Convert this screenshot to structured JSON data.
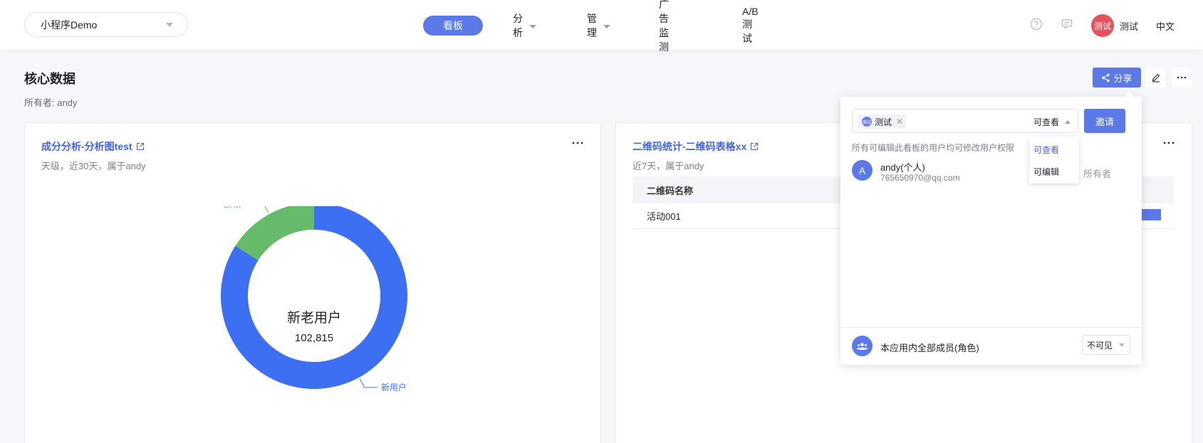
{
  "header": {
    "app_select": "小程序Demo",
    "nav": [
      {
        "label": "看板",
        "active": true
      },
      {
        "label": "分析",
        "has_caret": true
      },
      {
        "label": "管理",
        "has_caret": true
      },
      {
        "label": "广告监测"
      },
      {
        "label": "A/B测试"
      }
    ],
    "avatar_text": "测试",
    "user_name": "测试",
    "language": "中文",
    "icons": [
      "help-circle-icon",
      "message-icon"
    ]
  },
  "page": {
    "title": "核心数据",
    "owner": "所有者: andy",
    "share_label": "分享"
  },
  "card_left": {
    "title": "成分分析-分析图test",
    "subtitle": "天级，近30天，属于andy"
  },
  "card_right": {
    "title": "二维码统计-二维码表格xx",
    "subtitle": "近7天，属于andy",
    "table": {
      "columns": [
        "二维码名称"
      ],
      "rows": [
        [
          "活动001"
        ]
      ]
    }
  },
  "chart_data": {
    "type": "pie",
    "center_title": "新老用户",
    "center_value": "102,815",
    "slices": [
      {
        "label": "新用户",
        "value": 0.84,
        "color": "#3d6ff2"
      },
      {
        "label": "老用户",
        "value": 0.16,
        "color": "#66bb6a"
      }
    ]
  },
  "share_popover": {
    "tag_avatar": "测试",
    "tag_label": "测试",
    "permission_value": "可查看",
    "invite_button": "邀请",
    "hint": "所有可编辑此看板的用户均可修改用户权限",
    "member": {
      "initial": "A",
      "name": "andy(个人)",
      "email": "765650970@qq.com",
      "role": "所有者"
    },
    "dropdown_options": [
      {
        "label": "可查看",
        "selected": true
      },
      {
        "label": "可编辑",
        "selected": false
      }
    ],
    "group": {
      "label": "本应用内全部成员(角色)",
      "visibility": "不可见"
    }
  },
  "colors": {
    "accent": "#5b7ae8",
    "link": "#4164e5",
    "avatar_red": "#e8505b",
    "green": "#66bb6a"
  }
}
